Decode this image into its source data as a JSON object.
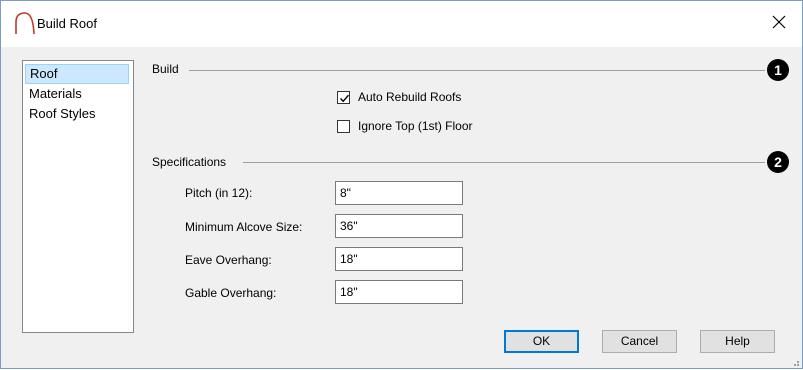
{
  "window": {
    "title": "Build Roof",
    "icon": "roof-arc-icon",
    "close_icon": "close-icon"
  },
  "nav": {
    "items": [
      {
        "label": "Roof",
        "selected": true
      },
      {
        "label": "Materials",
        "selected": false
      },
      {
        "label": "Roof Styles",
        "selected": false
      }
    ]
  },
  "build": {
    "label": "Build",
    "callout": "1",
    "auto_rebuild": {
      "label": "Auto Rebuild Roofs",
      "checked": true
    },
    "ignore_top_floor": {
      "label": "Ignore Top (1st) Floor",
      "checked": false
    }
  },
  "specs": {
    "label": "Specifications",
    "callout": "2",
    "pitch": {
      "label": "Pitch (in 12):",
      "value": "8\""
    },
    "min_alcove": {
      "label": "Minimum Alcove Size:",
      "value": "36\""
    },
    "eave": {
      "label": "Eave Overhang:",
      "value": "18\""
    },
    "gable": {
      "label": "Gable Overhang:",
      "value": "18\""
    }
  },
  "buttons": {
    "ok": "OK",
    "cancel": "Cancel",
    "help": "Help"
  },
  "colors": {
    "selection": "#cce8ff",
    "default_button_border": "#0078d7",
    "title_icon": "#c0392b"
  }
}
